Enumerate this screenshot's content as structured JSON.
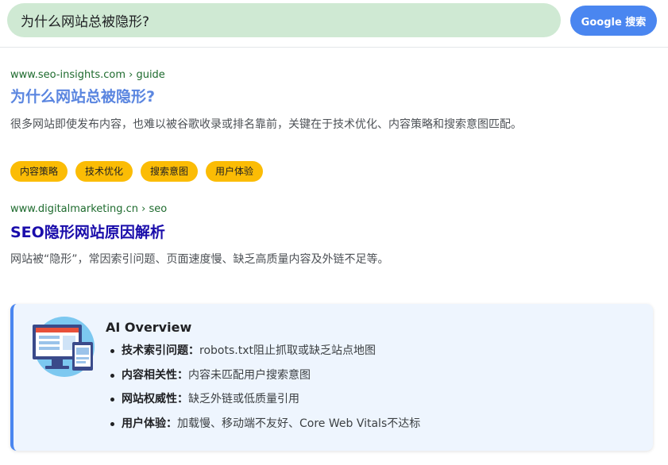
{
  "search": {
    "query": "为什么网站总被隐形?",
    "button_label": "Google 搜索"
  },
  "results": [
    {
      "url": "www.seo-insights.com › guide",
      "title": "为什么网站总被隐形?",
      "snippet": "很多网站即使发布内容，也难以被谷歌收录或排名靠前，关键在于技术优化、内容策略和搜索意图匹配。",
      "tags": [
        "内容策略",
        "技术优化",
        "搜索意图",
        "用户体验"
      ]
    },
    {
      "url": "www.digitalmarketing.cn › seo",
      "title": "SEO隐形网站原因解析",
      "snippet": "网站被“隐形”，常因索引问题、页面速度慢、缺乏高质量内容及外链不足等。"
    }
  ],
  "ai_overview": {
    "title": "AI Overview",
    "illustration_icon": "computer-screens-illustration",
    "items": [
      {
        "key": "技术索引问题：",
        "value": "robots.txt阻止抓取或缺乏站点地图"
      },
      {
        "key": "内容相关性：",
        "value": "内容未匹配用户搜索意图"
      },
      {
        "key": "网站权威性：",
        "value": "缺乏外链或低质量引用"
      },
      {
        "key": "用户体验：",
        "value": "加载慢、移动端不友好、Core Web Vitals不达标"
      }
    ]
  },
  "colors": {
    "search_bg": "#cfe9d3",
    "button_bg": "#4a86f0",
    "tag_bg": "#fbbc05",
    "url_green": "#1e6b2e",
    "title1": "#5b86e0",
    "title2": "#1a0dab",
    "ai_bg": "#eef5fe"
  }
}
